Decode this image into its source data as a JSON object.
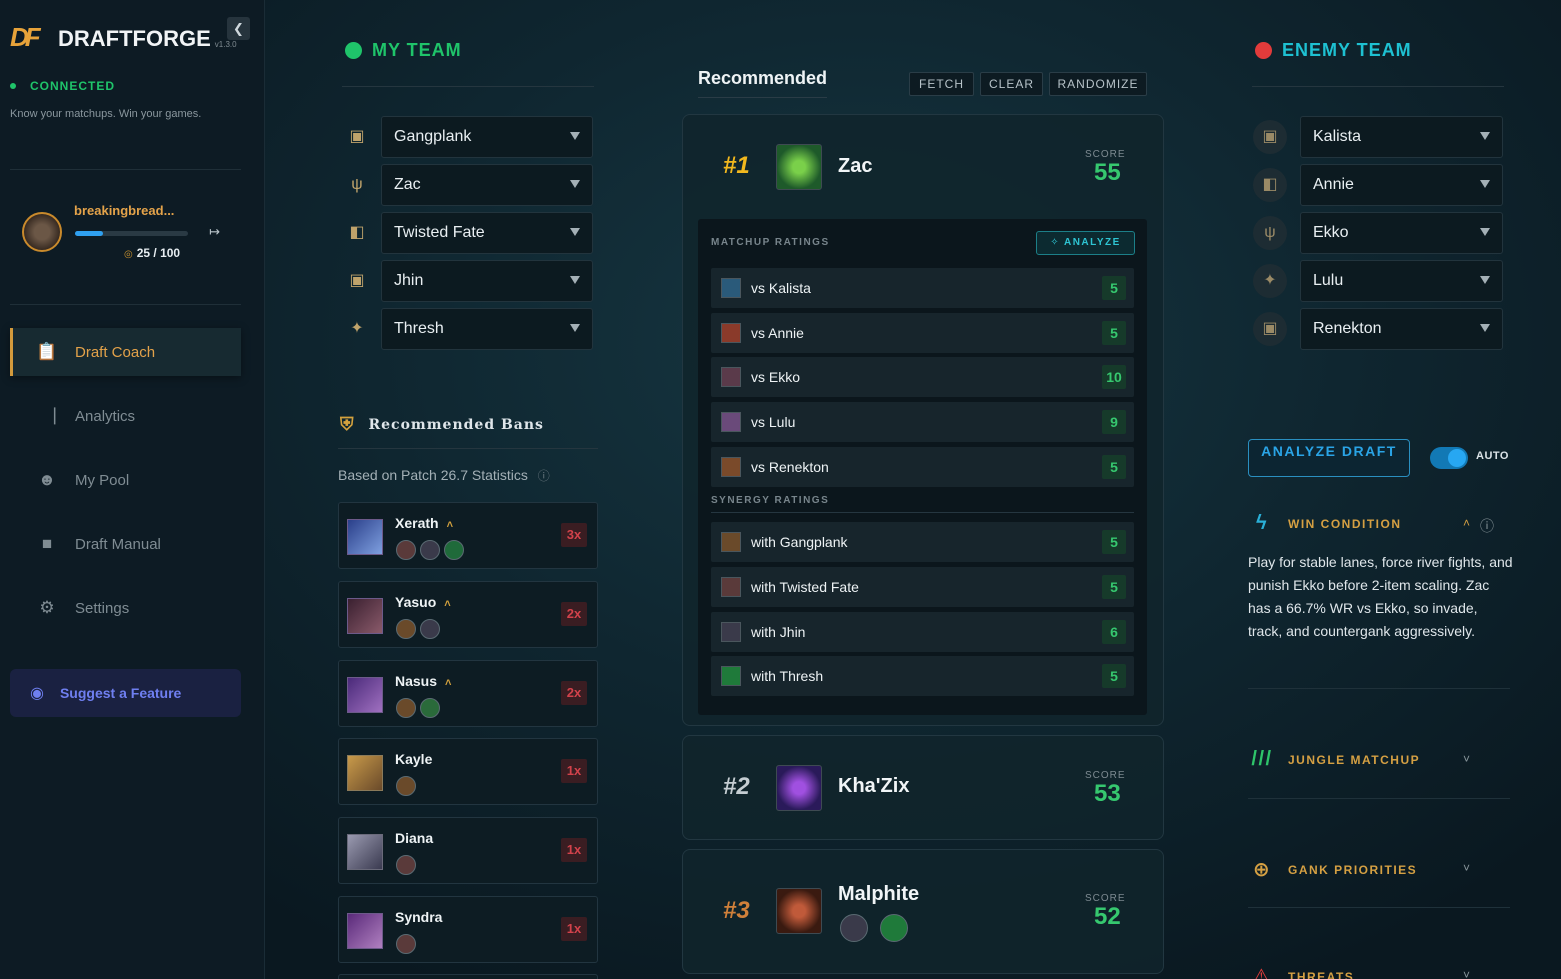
{
  "app": {
    "name": "DRAFTFORGE",
    "version": "v1.3.0",
    "logo_mark": "DF",
    "status": "CONNECTED",
    "tagline": "Know your matchups. Win your games."
  },
  "profile": {
    "name": "breakingbread...",
    "coins": "25 / 100",
    "progress": 0.25
  },
  "nav": [
    {
      "label": "Draft Coach",
      "icon": "clipboard-icon",
      "active": true
    },
    {
      "label": "Analytics",
      "icon": "bar-chart-icon",
      "active": false
    },
    {
      "label": "My Pool",
      "icon": "users-icon",
      "active": false
    },
    {
      "label": "Draft Manual",
      "icon": "book-icon",
      "active": false
    },
    {
      "label": "Settings",
      "icon": "gear-icon",
      "active": false
    }
  ],
  "suggest": {
    "label": "Suggest a Feature",
    "icon": "discord-icon"
  },
  "my_team": {
    "title": "MY TEAM",
    "color": "#1fc46a",
    "picks": [
      {
        "role": "top",
        "champion": "Gangplank"
      },
      {
        "role": "jungle",
        "champion": "Zac"
      },
      {
        "role": "mid",
        "champion": "Twisted Fate"
      },
      {
        "role": "bot",
        "champion": "Jhin"
      },
      {
        "role": "support",
        "champion": "Thresh"
      }
    ]
  },
  "enemy_team": {
    "title": "ENEMY TEAM",
    "color": "#e23b3b",
    "picks": [
      {
        "role": "top",
        "champion": "Kalista"
      },
      {
        "role": "mid",
        "champion": "Annie"
      },
      {
        "role": "jungle",
        "champion": "Ekko"
      },
      {
        "role": "support",
        "champion": "Lulu"
      },
      {
        "role": "bot",
        "champion": "Renekton"
      }
    ]
  },
  "bans": {
    "title": "Recommended Bans",
    "subtitle": "Based on Patch 26.7 Statistics",
    "items": [
      {
        "name": "Xerath",
        "mult": "3x",
        "color": "#3a5fb0"
      },
      {
        "name": "Yasuo",
        "mult": "2x",
        "color": "#5a3a6a"
      },
      {
        "name": "Nasus",
        "mult": "2x",
        "color": "#6a3aa0"
      },
      {
        "name": "Kayle",
        "mult": "1x",
        "color": "#b08a3a"
      },
      {
        "name": "Diana",
        "mult": "1x",
        "color": "#7a7a90"
      },
      {
        "name": "Syndra",
        "mult": "1x",
        "color": "#6a3a8a"
      }
    ]
  },
  "recommended": {
    "title": "Recommended",
    "buttons": [
      "FETCH",
      "CLEAR",
      "RANDOMIZE"
    ],
    "picks": [
      {
        "rank": "#1",
        "name": "Zac",
        "score_label": "SCORE",
        "score": "55"
      },
      {
        "rank": "#2",
        "name": "Kha'Zix",
        "score_label": "SCORE",
        "score": "53"
      },
      {
        "rank": "#3",
        "name": "Malphite",
        "score_label": "SCORE",
        "score": "52"
      }
    ],
    "matchup_label": "MATCHUP RATINGS",
    "analyze_label": "ANALYZE",
    "synergy_label": "SYNERGY RATINGS",
    "matchups": [
      {
        "text": "vs Kalista",
        "value": "5"
      },
      {
        "text": "vs Annie",
        "value": "5"
      },
      {
        "text": "vs Ekko",
        "value": "10"
      },
      {
        "text": "vs Lulu",
        "value": "9"
      },
      {
        "text": "vs Renekton",
        "value": "5"
      }
    ],
    "synergies": [
      {
        "text": "with Gangplank",
        "value": "5"
      },
      {
        "text": "with Twisted Fate",
        "value": "5"
      },
      {
        "text": "with Jhin",
        "value": "6"
      },
      {
        "text": "with Thresh",
        "value": "5"
      }
    ]
  },
  "right": {
    "analyze_label": "ANALYZE DRAFT",
    "auto_label": "AUTO",
    "win_condition": {
      "title": "WIN CONDITION",
      "text": "Play for stable lanes, force river fights, and punish Ekko before 2-item scaling. Zac has a 66.7% WR vs Ekko, so invade, track, and countergank aggressively."
    },
    "jungle_matchup": "JUNGLE MATCHUP",
    "gank_priorities": "GANK PRIORITIES",
    "threats": "THREATS"
  }
}
